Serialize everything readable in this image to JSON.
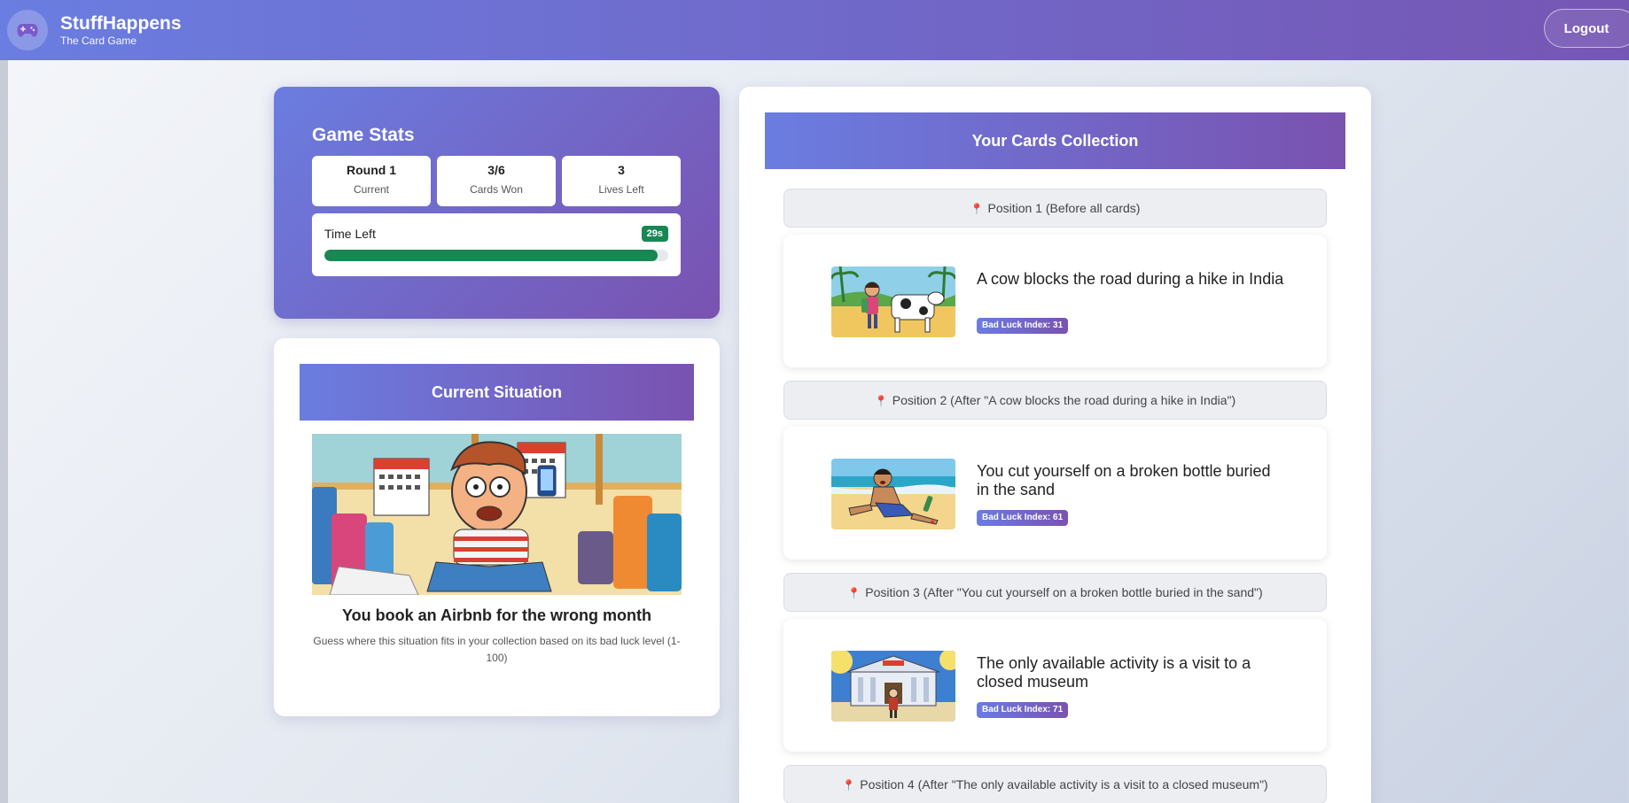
{
  "nav": {
    "title": "StuffHappens",
    "subtitle": "The Card Game",
    "logo_icon": "gamepad-icon",
    "logout_label": "Logout"
  },
  "stats": {
    "title": "Game Stats",
    "round_value": "Round 1",
    "round_label": "Current",
    "cards_value": "3/6",
    "cards_label": "Cards Won",
    "lives_value": "3",
    "lives_label": "Lives Left",
    "time_label": "Time Left",
    "time_badge": "29s",
    "time_progress": 0.97
  },
  "situation": {
    "header": "Current Situation",
    "title": "You book an Airbnb for the wrong month",
    "description": "Guess where this situation fits in your collection based on its bad luck level (1-100)"
  },
  "collection": {
    "header": "Your Cards Collection",
    "positions": [
      "Position 1 (Before all cards)",
      "Position 2 (After \"A cow blocks the road during a hike in India\")",
      "Position 3 (After \"You cut yourself on a broken bottle buried in the sand\")",
      "Position 4 (After \"The only available activity is a visit to a closed museum\")"
    ],
    "cards": [
      {
        "title": "A cow blocks the road during a hike in India",
        "badge": "Bad Luck Index: 31"
      },
      {
        "title": "You cut yourself on a broken bottle buried in the sand",
        "badge": "Bad Luck Index: 61"
      },
      {
        "title": "The only available activity is a visit to a closed museum",
        "badge": "Bad Luck Index: 71"
      }
    ]
  },
  "colors": {
    "brand_start": "#6a7de0",
    "brand_end": "#7656b4",
    "timer_green": "#198754",
    "pin_red": "#dc3545"
  }
}
